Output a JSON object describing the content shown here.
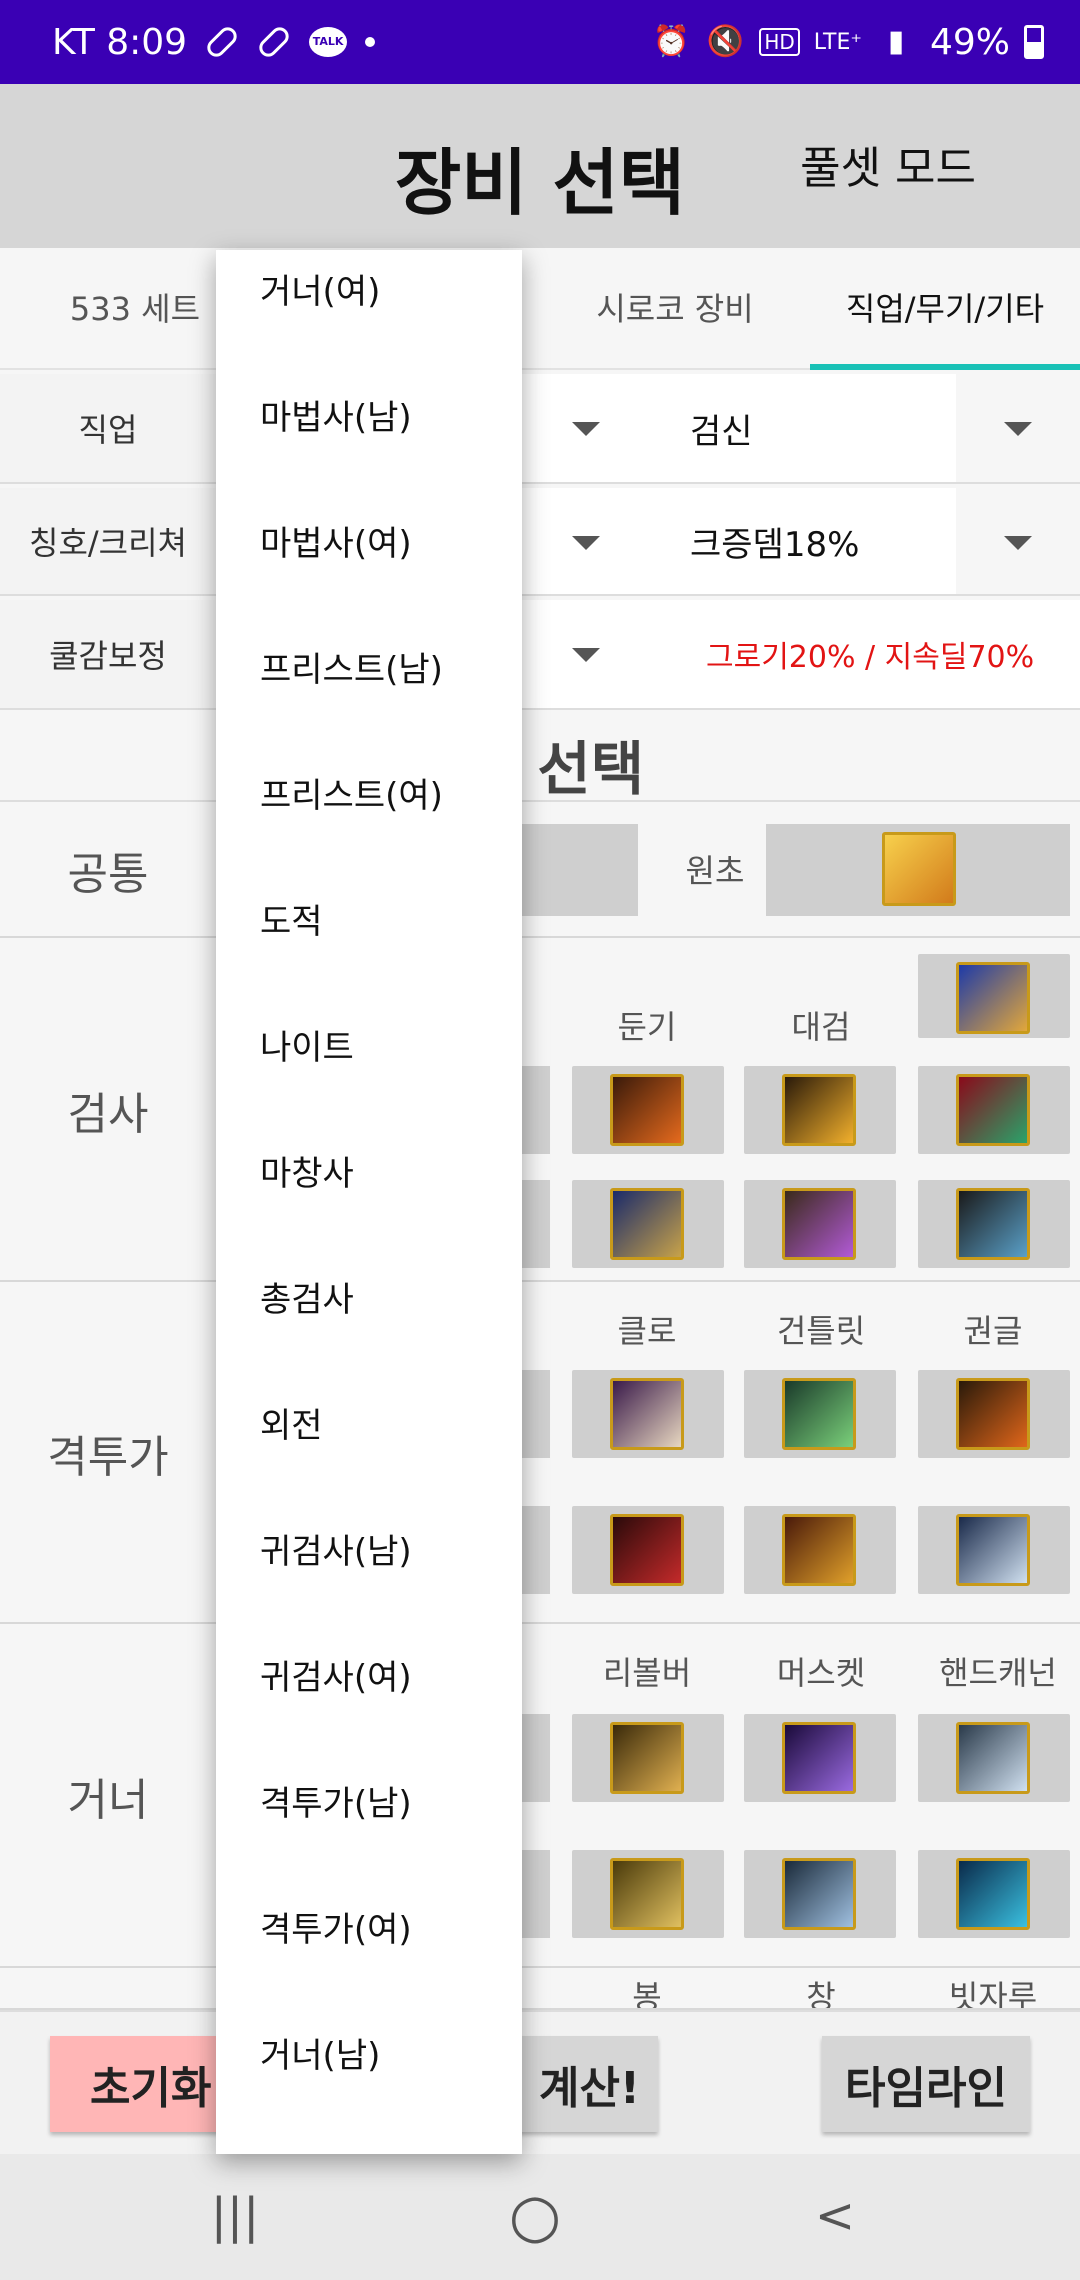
{
  "status_bar": {
    "carrier_time": "KT 8:09",
    "talk": "TALK",
    "hd": "HD",
    "lte": "LTE⁺",
    "battery": "49%"
  },
  "header": {
    "title": "장비 선택",
    "mode_button": "풀셋 모드"
  },
  "tabs": [
    {
      "label": "533 세트"
    },
    {
      "label": "시로코 장비"
    },
    {
      "label": "직업/무기/기타"
    }
  ],
  "filters": {
    "job": {
      "label": "직업",
      "value": "검신"
    },
    "title": {
      "label": "칭호/크리쳐",
      "value": "크증뎀18%"
    },
    "cooldown": {
      "label": "쿨감보정",
      "value": "그로기20% / 지속딜70%"
    }
  },
  "section": {
    "title_visible": "| 선택"
  },
  "categories": {
    "common": {
      "label": "공통",
      "slot_label": "원초"
    },
    "swordsman": {
      "label": "검사",
      "cols": [
        "둔기",
        "대검"
      ]
    },
    "fighter": {
      "label": "격투가",
      "cols": [
        "클로",
        "건틀릿",
        "권글"
      ]
    },
    "gunner": {
      "label": "거너",
      "cols": [
        "리볼버",
        "머스켓",
        "핸드캐넌"
      ]
    },
    "next": {
      "cols": [
        "봉",
        "창",
        "빗자루"
      ]
    }
  },
  "dropdown": {
    "items": [
      "거너(여)",
      "마법사(남)",
      "마법사(여)",
      "프리스트(남)",
      "프리스트(여)",
      "도적",
      "나이트",
      "마창사",
      "총검사",
      "외전",
      "귀검사(남)",
      "귀검사(여)",
      "격투가(남)",
      "격투가(여)",
      "거너(남)"
    ]
  },
  "bottom": {
    "reset": "초기화",
    "calc_partial": "계산!",
    "timeline": "타임라인"
  },
  "nav": {
    "recents": "|||",
    "home": "○",
    "back": "<"
  },
  "colors": {
    "status_bar": "#3a00b4",
    "tab_indicator": "#19c1b6",
    "cooldown_text": "#e21414",
    "reset_button": "#ffb6b6"
  }
}
